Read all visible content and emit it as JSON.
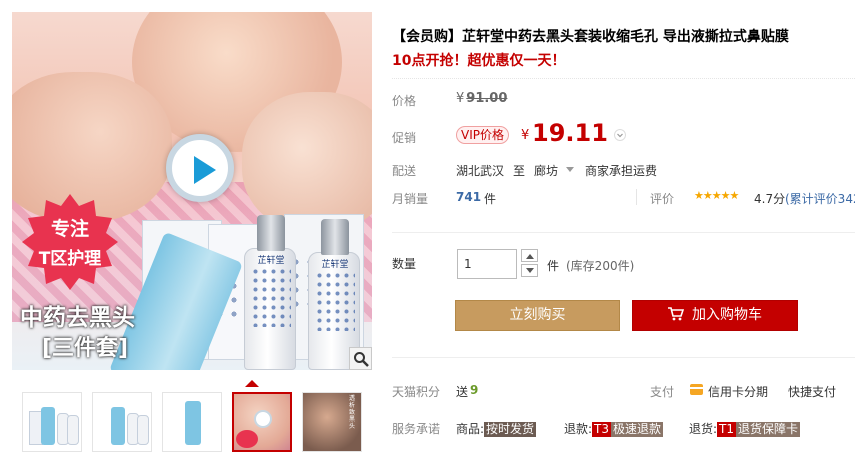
{
  "gallery": {
    "badge_line1": "专注",
    "badge_line2": "T区护理",
    "caption_line1": "中药去黑头",
    "caption_line2": "[三件套]",
    "product_brand": "芷轩堂",
    "thumb_vertical_text": "透析致黑头",
    "colors": {
      "badge": "#e8334f",
      "active_thumb": "#c40000"
    }
  },
  "product": {
    "title": "【会员购】芷轩堂中药去黑头套装收缩毛孔 导出液撕拉式鼻贴膜",
    "subtitle": "10点开抢！超优惠仅一天！"
  },
  "price": {
    "label": "价格",
    "currency": "¥",
    "original": "91.00"
  },
  "promo": {
    "label": "促销",
    "vip_tag": "VIP价格",
    "currency": "¥",
    "price": "19.11"
  },
  "shipping": {
    "label": "配送",
    "from": "湖北武汉",
    "to_word": "至",
    "destination": "廊坊",
    "fee": "商家承担运费"
  },
  "sales": {
    "label": "月销量",
    "count": "741",
    "unit": "件"
  },
  "rating": {
    "label": "评价",
    "stars": "★★★★★",
    "score": "4.7分",
    "link": "(累计评价342"
  },
  "quantity": {
    "label": "数量",
    "value": "1",
    "unit": "件",
    "stock": "(库存200件)"
  },
  "actions": {
    "buy_now": "立刻购买",
    "add_to_cart": "加入购物车"
  },
  "services": {
    "points_label": "天猫积分",
    "points_prefix": "送",
    "points_value": "9",
    "pay_label": "支付",
    "pay_credit": "信用卡分期",
    "pay_fast": "快捷支付",
    "promise_label": "服务承诺",
    "promise_goods_prefix": "商品:",
    "promise_goods_tag": "按时发货",
    "promise_refund_prefix": "退款:",
    "promise_refund_code": "T3",
    "promise_refund_tag": "极速退款",
    "promise_return_prefix": "退货:",
    "promise_return_code": "T1",
    "promise_return_tag": "退货保障卡"
  },
  "theme": {
    "accent": "#c40000",
    "buy_button": "#c79b5f",
    "link": "#3c6aa6"
  }
}
